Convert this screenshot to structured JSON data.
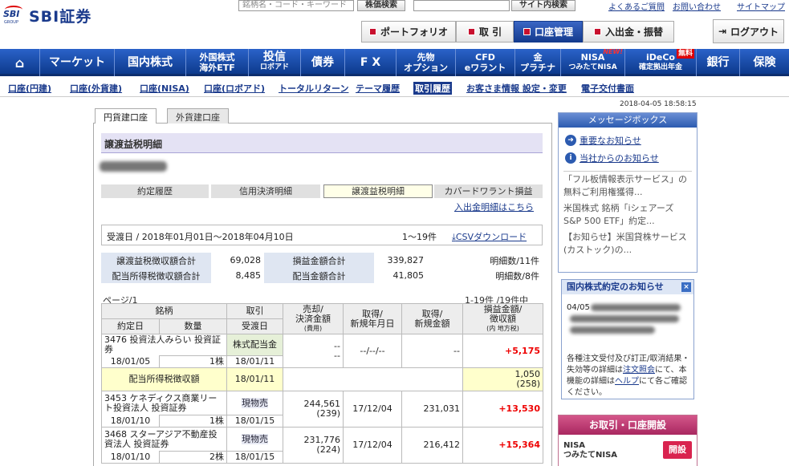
{
  "header": {
    "brand": "SBI証券",
    "brand_mark": "SBI",
    "brand_group": "GROUP",
    "search_placeholder": "銘柄名・コード・キーワード",
    "stock_search": "株価検索",
    "site_search": "サイト内検索",
    "links": [
      "よくあるご質問",
      "お問い合わせ",
      "サイトマップ"
    ],
    "nav": [
      {
        "label": "ポートフォリオ"
      },
      {
        "label": "取 引"
      },
      {
        "label": "口座管理"
      },
      {
        "label": "入出金・振替"
      }
    ],
    "logout": "ログアウト"
  },
  "mainnav": [
    {
      "l1": "マーケット"
    },
    {
      "l1": "国内株式"
    },
    {
      "l1": "外国株式",
      "l2": "海外ETF"
    },
    {
      "l1": "投信",
      "l2": "ロボアド"
    },
    {
      "l1": "債券"
    },
    {
      "l1": "F X"
    },
    {
      "l1": "先物",
      "l2": "オプション"
    },
    {
      "l1": "CFD",
      "l2": "eワラント"
    },
    {
      "l1": "金",
      "l2": "プラチナ"
    },
    {
      "l1": "NISA",
      "l2": "つみたてNISA",
      "badge": "NEW!"
    },
    {
      "l1": "iDeCo",
      "l2": "確定拠出年金",
      "badge": "無料"
    },
    {
      "l1": "銀行"
    },
    {
      "l1": "保険"
    }
  ],
  "subnav": [
    "口座(円建)",
    "口座(外貨建)",
    "口座(NISA)",
    "口座(ロボアド)",
    "トータルリターン",
    "テーマ履歴",
    "取引履歴",
    "お客さま情報 設定・変更",
    "電子交付書面"
  ],
  "datetime": "2018-04-05 18:58:15",
  "tabs": [
    "円貨建口座",
    "外貨建口座"
  ],
  "section_title": "譲渡益税明細",
  "subtabs": [
    "約定履歴",
    "信用決済明細",
    "譲渡益税明細",
    "カバードワラント損益"
  ],
  "deposit_link": "入出金明細はこちら",
  "range": {
    "text": "受渡日 / 2018年01月01日〜2018年04月10日",
    "count": "1〜19件",
    "csv": "CSVダウンロード"
  },
  "summary": [
    {
      "l1": "譲渡益税徴収額合計",
      "v1": "69,028",
      "l2": "損益金額合計",
      "v2": "339,827",
      "c": "明細数/11件"
    },
    {
      "l1": "配当所得税徴収額合計",
      "v1": "8,485",
      "l2": "配当金額合計",
      "v2": "41,805",
      "c": "明細数/8件"
    }
  ],
  "page": "ページ/1",
  "page_count": "1-19件 /19件中",
  "table_headers": {
    "meigara": "銘柄",
    "torihiki": "取引",
    "sell": "売却/",
    "sell2": "決済金額",
    "sell3": "(費用)",
    "acq": "取得/",
    "acq2": "新規年月日",
    "acqamt": "取得/",
    "acqamt2": "新規金額",
    "pl": "損益金額/",
    "pl2": "徴収額",
    "pl3": "(内 地方税)",
    "yakujo": "約定日",
    "qty": "数量",
    "ukewatashi": "受渡日"
  },
  "rows": [
    {
      "name": "3476 投資法人みらい 投資証券",
      "trade": "株式配当金",
      "sell": "--",
      "sell_fee": "--",
      "acq_date": "--/--/--",
      "acq_amt": "--",
      "pl": "+5,175",
      "date": "18/01/05",
      "qty": "1株",
      "settle": "18/01/11"
    },
    {
      "tax_label": "配当所得税徴収額",
      "settle": "18/01/11",
      "tax": "1,050",
      "tax_local": "(258)"
    },
    {
      "name": "3453 ケネディクス商業リート投資法人 投資証券",
      "trade": "現物売",
      "sell": "244,561",
      "sell_fee": "(239)",
      "acq_date": "17/12/04",
      "acq_amt": "231,031",
      "pl": "+13,530",
      "date": "18/01/10",
      "qty": "1株",
      "settle": "18/01/15"
    },
    {
      "name": "3468 スターアジア不動産投資法人 投資証券",
      "trade": "現物売",
      "sell": "231,776",
      "sell_fee": "(224)",
      "acq_date": "17/12/04",
      "acq_amt": "216,412",
      "pl": "+15,364",
      "date": "18/01/10",
      "qty": "2株",
      "settle": "18/01/15"
    }
  ],
  "messagebox": {
    "title": "メッセージボックス",
    "important": "重要なお知らせ",
    "company": "当社からのお知らせ",
    "news": [
      "「フル板情報表示サービス」の無料ご利用権獲得...",
      "米国株式 銘柄「iシェアーズ S&P 500 ETF」約定...",
      "【お知らせ】米国貸株サービス(カストック)の..."
    ]
  },
  "kyakutei": {
    "title": "国内株式約定のお知らせ",
    "date": "04/05",
    "close": "×",
    "notes": [
      "各種注文受付及び訂正/取消結果・失効等の詳細は",
      "注文照会",
      "にて、本機能の詳細は",
      "ヘルプ",
      "にて各ご確認ください。"
    ]
  },
  "account": {
    "title": "お取引・口座開設",
    "nisa1": "NISA",
    "nisa2": "つみたてNISA",
    "open": "開設"
  }
}
